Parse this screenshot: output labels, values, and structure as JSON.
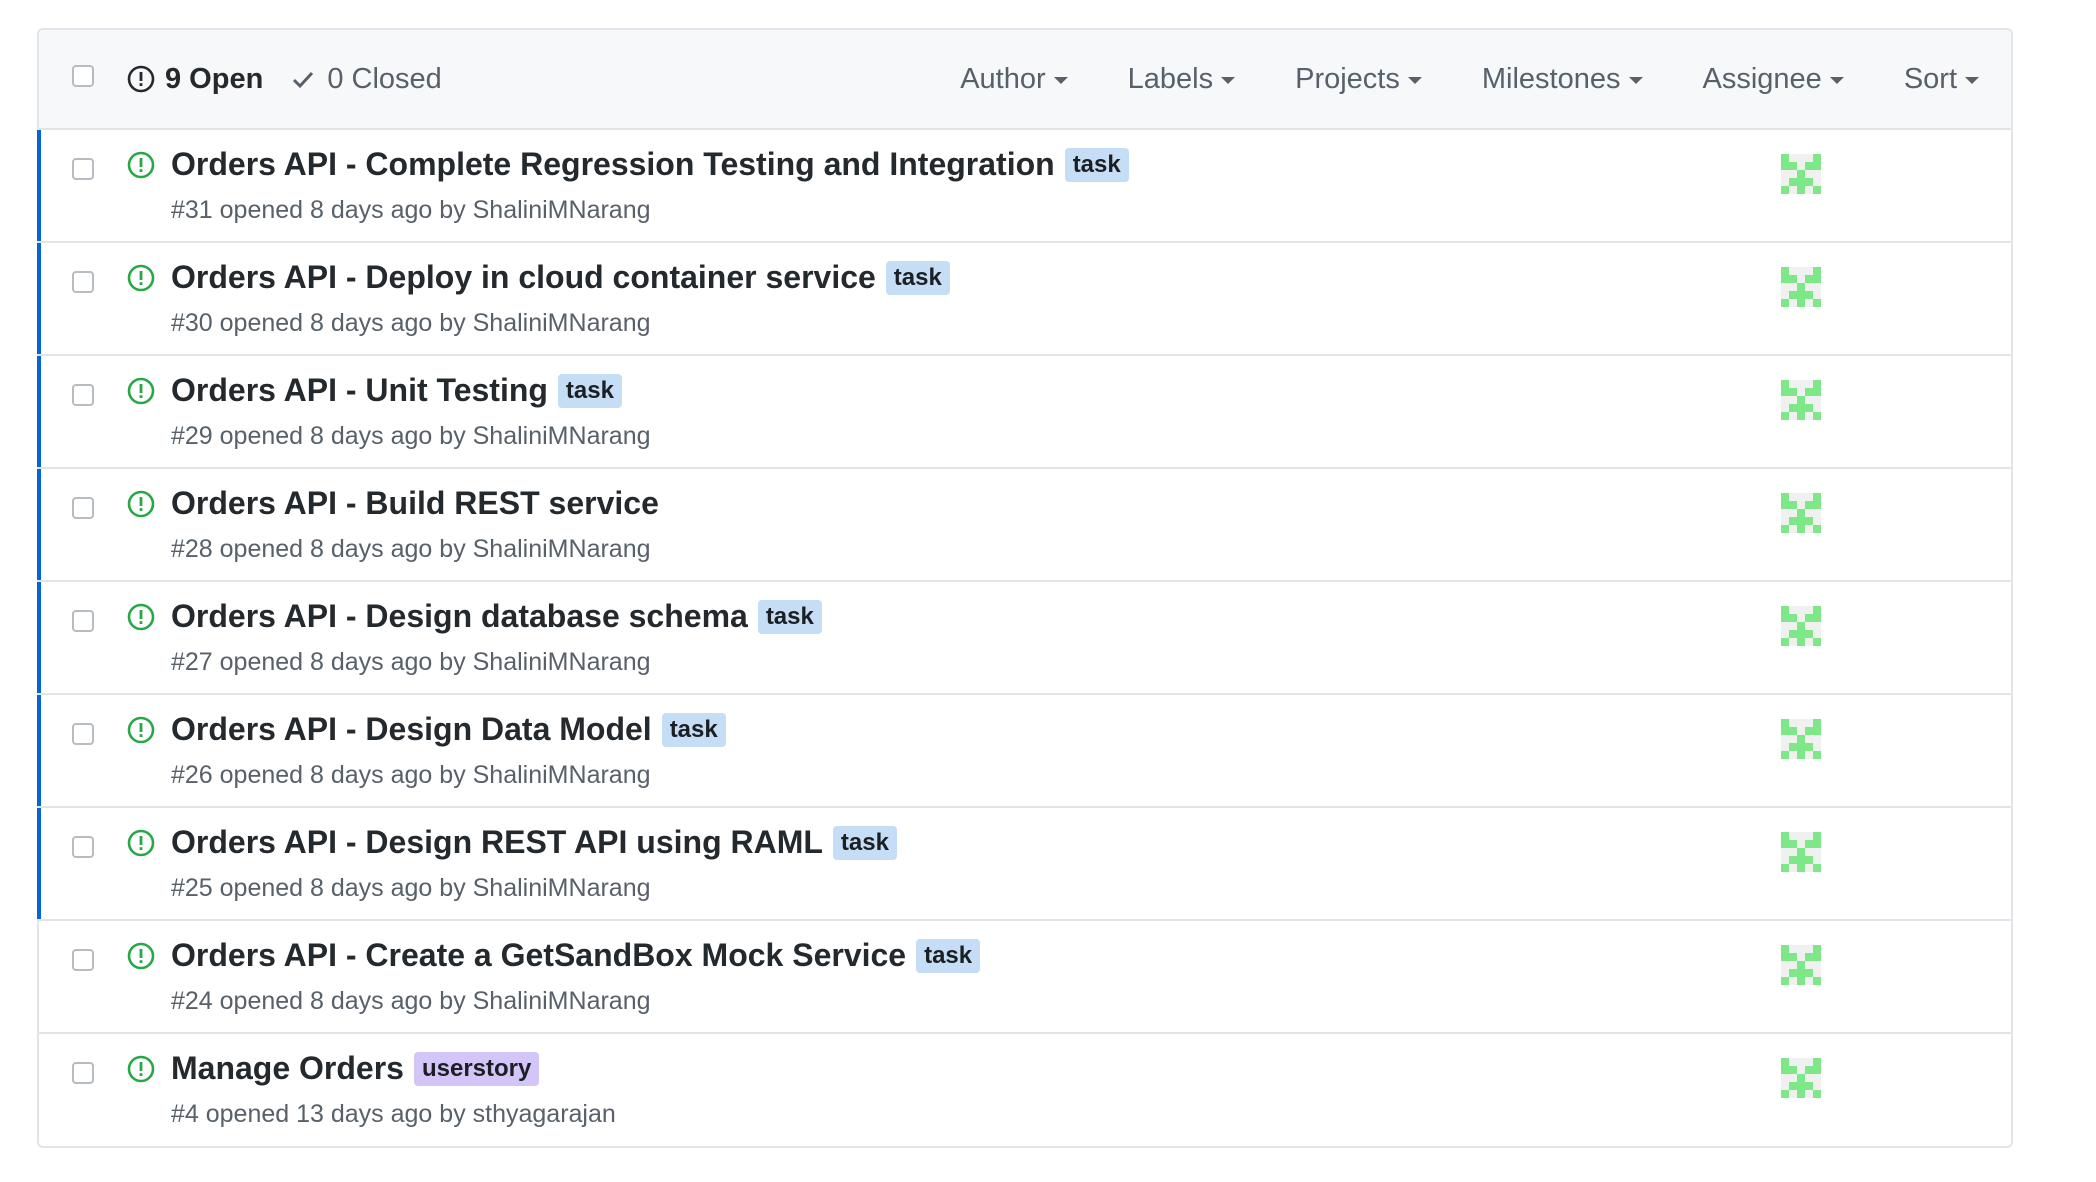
{
  "header": {
    "open_count_label": "9 Open",
    "closed_count_label": "0 Closed",
    "filters": [
      "Author",
      "Labels",
      "Projects",
      "Milestones",
      "Assignee",
      "Sort"
    ]
  },
  "colors": {
    "open_icon": "#28a745",
    "unread_bar": "#0366d6",
    "label_task": "#c5def5",
    "label_userstory": "#d4c5f9",
    "avatar_green": "#7ee787"
  },
  "icons": {
    "open_state": "issue-opened-icon",
    "closed_state": "check-icon",
    "assignee": "identicon-avatar"
  },
  "issues": [
    {
      "title": "Orders API - Complete Regression Testing and Integration",
      "label": "task",
      "meta": "#31 opened 8 days ago by ShaliniMNarang",
      "unread": true
    },
    {
      "title": "Orders API - Deploy in cloud container service",
      "label": "task",
      "meta": "#30 opened 8 days ago by ShaliniMNarang",
      "unread": true
    },
    {
      "title": "Orders API - Unit Testing",
      "label": "task",
      "meta": "#29 opened 8 days ago by ShaliniMNarang",
      "unread": true
    },
    {
      "title": "Orders API - Build REST service",
      "label": "",
      "meta": "#28 opened 8 days ago by ShaliniMNarang",
      "unread": true
    },
    {
      "title": "Orders API - Design database schema",
      "label": "task",
      "meta": "#27 opened 8 days ago by ShaliniMNarang",
      "unread": true
    },
    {
      "title": "Orders API - Design Data Model",
      "label": "task",
      "meta": "#26 opened 8 days ago by ShaliniMNarang",
      "unread": true
    },
    {
      "title": "Orders API - Design REST API using RAML",
      "label": "task",
      "meta": "#25 opened 8 days ago by ShaliniMNarang",
      "unread": true
    },
    {
      "title": "Orders API - Create a GetSandBox Mock Service",
      "label": "task",
      "meta": "#24 opened 8 days ago by ShaliniMNarang",
      "unread": false
    },
    {
      "title": "Manage Orders",
      "label": "userstory",
      "meta": "#4 opened 13 days ago by sthyagarajan",
      "unread": false
    }
  ]
}
